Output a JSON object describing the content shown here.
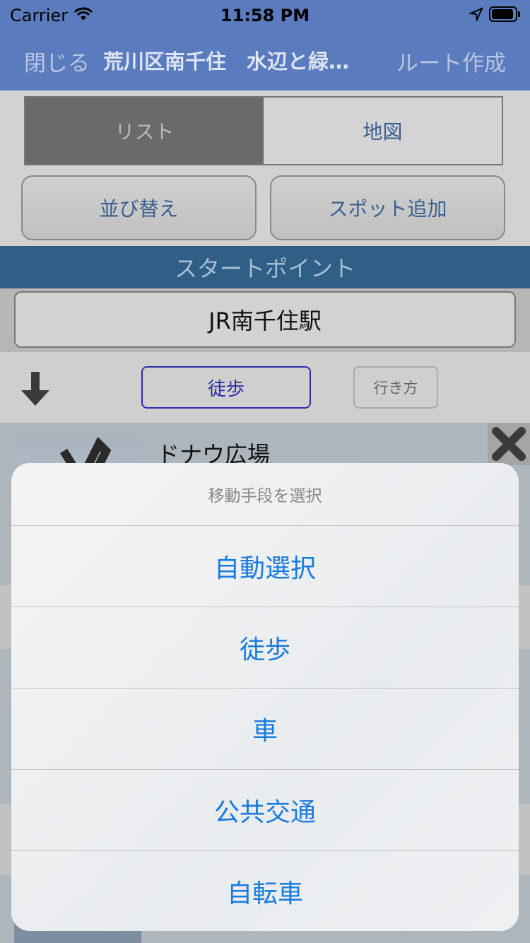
{
  "status": {
    "carrier": "Carrier",
    "time": "11:58 PM"
  },
  "nav": {
    "close": "閉じる",
    "title": "荒川区南千住　水辺と緑…",
    "route": "ルート作成"
  },
  "segment": {
    "list": "リスト",
    "map": "地図",
    "selected": "リスト"
  },
  "buttons": {
    "sort": "並び替え",
    "add_spot": "スポット追加"
  },
  "start": {
    "header": "スタートポイント",
    "value": "JR南千住駅"
  },
  "mode": {
    "walk": "徒歩",
    "howto": "行き方"
  },
  "spot": {
    "name": "ドナウ広場"
  },
  "sheet": {
    "title": "移動手段を選択",
    "options": [
      "自動選択",
      "徒歩",
      "車",
      "公共交通",
      "自転車"
    ]
  },
  "colors": {
    "nav": "#5a7bbd",
    "accent": "#1a7be0",
    "start_bar": "#2f5f86"
  },
  "icons": {
    "wifi": "wifi-icon",
    "location": "location-arrow-icon",
    "battery": "battery-icon",
    "down": "arrow-down-icon",
    "delete": "close-icon"
  }
}
